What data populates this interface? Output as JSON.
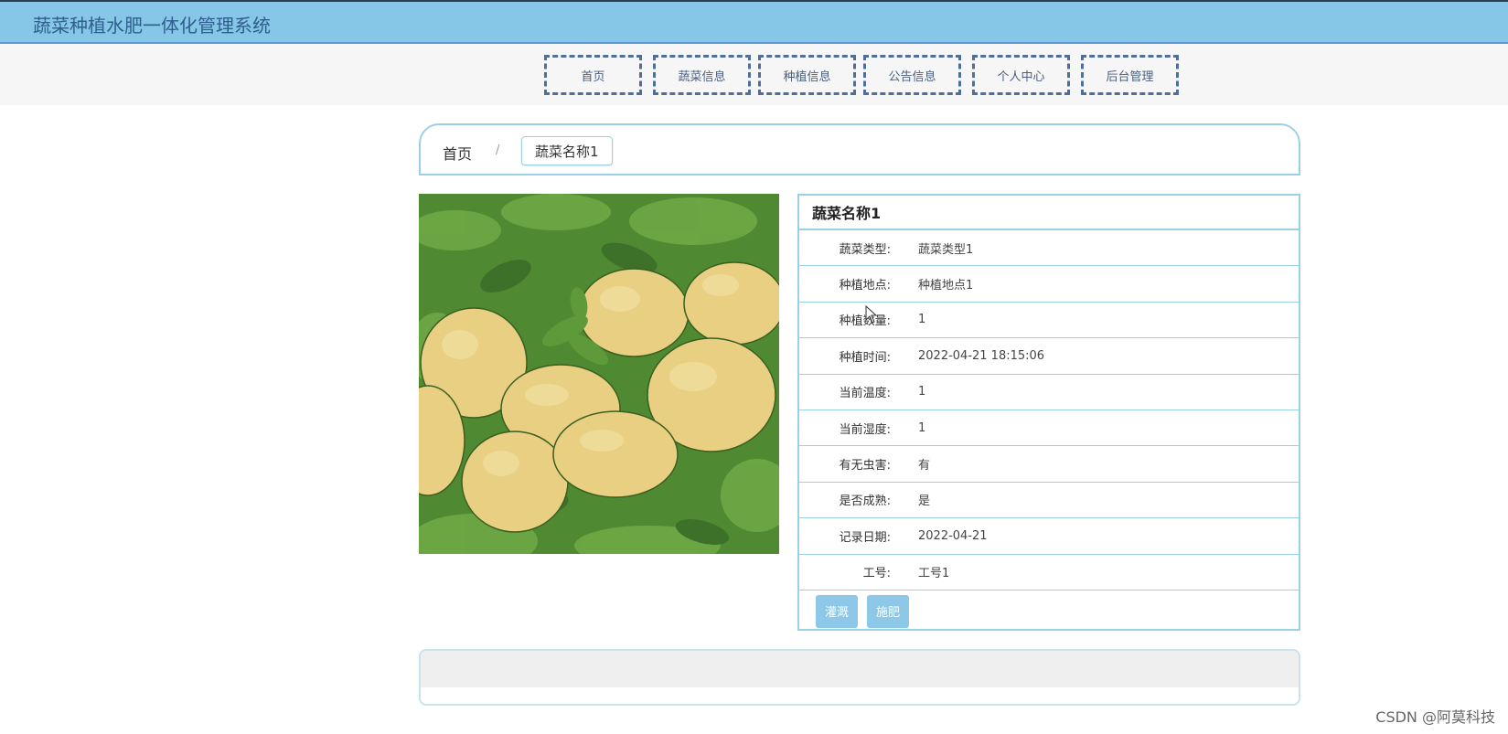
{
  "app": {
    "title": "蔬菜种植水肥一体化管理系统"
  },
  "nav": {
    "items": [
      {
        "label": "首页"
      },
      {
        "label": "蔬菜信息"
      },
      {
        "label": "种植信息"
      },
      {
        "label": "公告信息"
      },
      {
        "label": "个人中心"
      },
      {
        "label": "后台管理"
      }
    ]
  },
  "breadcrumb": {
    "home": "首页",
    "separator": "/",
    "current": "蔬菜名称1"
  },
  "photo": {
    "subject": "potatoes-with-leaves"
  },
  "detail": {
    "title": "蔬菜名称1",
    "rows": [
      {
        "label": "蔬菜类型:",
        "value": "蔬菜类型1"
      },
      {
        "label": "种植地点:",
        "value": "种植地点1"
      },
      {
        "label": "种植数量:",
        "value": "1"
      },
      {
        "label": "种植时间:",
        "value": "2022-04-21 18:15:06"
      },
      {
        "label": "当前温度:",
        "value": "1"
      },
      {
        "label": "当前湿度:",
        "value": "1"
      },
      {
        "label": "有无虫害:",
        "value": "有"
      },
      {
        "label": "是否成熟:",
        "value": "是"
      },
      {
        "label": "记录日期:",
        "value": "2022-04-21"
      },
      {
        "label": "工号:",
        "value": "工号1"
      }
    ],
    "actions": {
      "irrigate": "灌溉",
      "fertilize": "施肥"
    }
  },
  "watermark": "CSDN @阿莫科技",
  "colors": {
    "topbar": "#86c6e6",
    "nav_border": "#4f6e99",
    "panel_border": "#9bd0e6",
    "button": "#8ec8e8"
  }
}
